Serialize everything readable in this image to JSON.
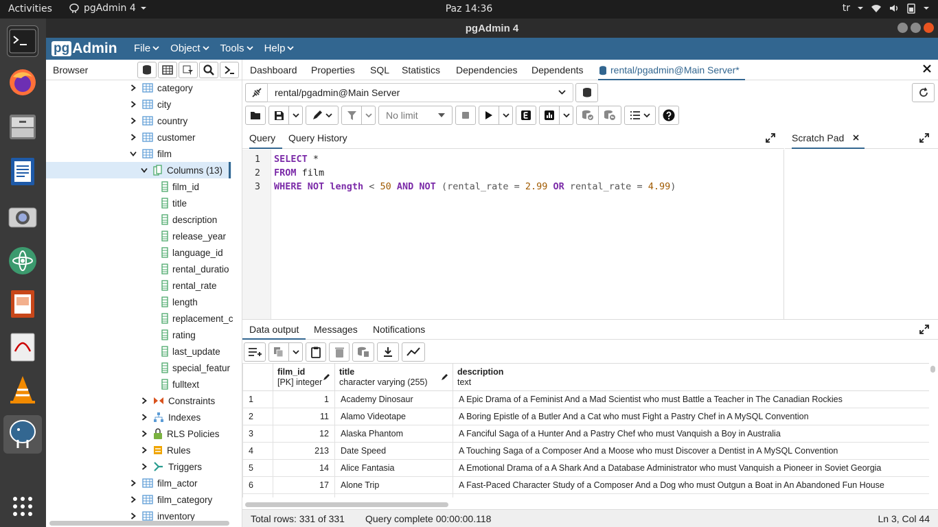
{
  "system_bar": {
    "activities": "Activities",
    "app_name": "pgAdmin 4",
    "clock": "Paz 14:36",
    "lang": "tr"
  },
  "window": {
    "title": "pgAdmin 4"
  },
  "menu": {
    "logo_pg": "pg",
    "logo_admin": "Admin",
    "items": [
      "File",
      "Object",
      "Tools",
      "Help"
    ]
  },
  "browser": {
    "title": "Browser",
    "tree": [
      {
        "label": "category",
        "indent": 0,
        "chevron": "right",
        "icon": "table"
      },
      {
        "label": "city",
        "indent": 0,
        "chevron": "right",
        "icon": "table"
      },
      {
        "label": "country",
        "indent": 0,
        "chevron": "right",
        "icon": "table"
      },
      {
        "label": "customer",
        "indent": 0,
        "chevron": "right",
        "icon": "table"
      },
      {
        "label": "film",
        "indent": 0,
        "chevron": "down",
        "icon": "table"
      },
      {
        "label": "Columns (13)",
        "indent": 1,
        "chevron": "down",
        "icon": "columns",
        "selected": true
      },
      {
        "label": "film_id",
        "indent": 2,
        "chevron": "",
        "icon": "column"
      },
      {
        "label": "title",
        "indent": 2,
        "chevron": "",
        "icon": "column"
      },
      {
        "label": "description",
        "indent": 2,
        "chevron": "",
        "icon": "column"
      },
      {
        "label": "release_year",
        "indent": 2,
        "chevron": "",
        "icon": "column"
      },
      {
        "label": "language_id",
        "indent": 2,
        "chevron": "",
        "icon": "column"
      },
      {
        "label": "rental_duratio",
        "indent": 2,
        "chevron": "",
        "icon": "column"
      },
      {
        "label": "rental_rate",
        "indent": 2,
        "chevron": "",
        "icon": "column"
      },
      {
        "label": "length",
        "indent": 2,
        "chevron": "",
        "icon": "column"
      },
      {
        "label": "replacement_c",
        "indent": 2,
        "chevron": "",
        "icon": "column"
      },
      {
        "label": "rating",
        "indent": 2,
        "chevron": "",
        "icon": "column"
      },
      {
        "label": "last_update",
        "indent": 2,
        "chevron": "",
        "icon": "column"
      },
      {
        "label": "special_featur",
        "indent": 2,
        "chevron": "",
        "icon": "column"
      },
      {
        "label": "fulltext",
        "indent": 2,
        "chevron": "",
        "icon": "column"
      },
      {
        "label": "Constraints",
        "indent": 1,
        "chevron": "right",
        "icon": "constraints"
      },
      {
        "label": "Indexes",
        "indent": 1,
        "chevron": "right",
        "icon": "indexes"
      },
      {
        "label": "RLS Policies",
        "indent": 1,
        "chevron": "right",
        "icon": "lock"
      },
      {
        "label": "Rules",
        "indent": 1,
        "chevron": "right",
        "icon": "rules"
      },
      {
        "label": "Triggers",
        "indent": 1,
        "chevron": "right",
        "icon": "triggers"
      },
      {
        "label": "film_actor",
        "indent": 0,
        "chevron": "right",
        "icon": "table"
      },
      {
        "label": "film_category",
        "indent": 0,
        "chevron": "right",
        "icon": "table"
      },
      {
        "label": "inventory",
        "indent": 0,
        "chevron": "right",
        "icon": "table"
      }
    ]
  },
  "tabs": [
    "Dashboard",
    "Properties",
    "SQL",
    "Statistics",
    "Dependencies",
    "Dependents"
  ],
  "active_tab": "rental/pgadmin@Main Server*",
  "connection": "rental/pgadmin@Main Server",
  "toolbar": {
    "limit": "No limit"
  },
  "query_tabs": [
    "Query",
    "Query History"
  ],
  "scratch_pad": "Scratch Pad",
  "editor": {
    "line_numbers": [
      "1",
      "2",
      "3"
    ],
    "line1": {
      "kw": "SELECT",
      "rest": " *"
    },
    "line2": {
      "kw": "FROM",
      "rest": " film"
    },
    "line3": {
      "p1": "WHERE",
      "p2": " ",
      "p3": "NOT",
      "p4": " ",
      "p5": "length",
      "p6": " < ",
      "p7": "50",
      "p8": " ",
      "p9": "AND",
      "p10": " ",
      "p11": "NOT",
      "p12": " (rental_rate = ",
      "p13": "2.99",
      "p14": " ",
      "p15": "OR",
      "p16": " rental_rate = ",
      "p17": "4.99",
      "p18": ")"
    }
  },
  "output_tabs": [
    "Data output",
    "Messages",
    "Notifications"
  ],
  "grid": {
    "columns": [
      {
        "name": "film_id",
        "type": "[PK] integer"
      },
      {
        "name": "title",
        "type": "character varying (255)"
      },
      {
        "name": "description",
        "type": "text"
      }
    ],
    "rows": [
      {
        "n": "1",
        "film_id": "1",
        "title": "Academy Dinosaur",
        "description": "A Epic Drama of a Feminist And a Mad Scientist who must Battle a Teacher in The Canadian Rockies"
      },
      {
        "n": "2",
        "film_id": "11",
        "title": "Alamo Videotape",
        "description": "A Boring Epistle of a Butler And a Cat who must Fight a Pastry Chef in A MySQL Convention"
      },
      {
        "n": "3",
        "film_id": "12",
        "title": "Alaska Phantom",
        "description": "A Fanciful Saga of a Hunter And a Pastry Chef who must Vanquish a Boy in Australia"
      },
      {
        "n": "4",
        "film_id": "213",
        "title": "Date Speed",
        "description": "A Touching Saga of a Composer And a Moose who must Discover a Dentist in A MySQL Convention"
      },
      {
        "n": "5",
        "film_id": "14",
        "title": "Alice Fantasia",
        "description": "A Emotional Drama of a A Shark And a Database Administrator who must Vanquish a Pioneer in Soviet Georgia"
      },
      {
        "n": "6",
        "film_id": "17",
        "title": "Alone Trip",
        "description": "A Fast-Paced Character Study of a Composer And a Dog who must Outgun a Boat in An Abandoned Fun House"
      }
    ]
  },
  "status": {
    "total_rows": "Total rows: 331 of 331",
    "query_time": "Query complete 00:00:00.118",
    "cursor": "Ln 3, Col 44"
  }
}
